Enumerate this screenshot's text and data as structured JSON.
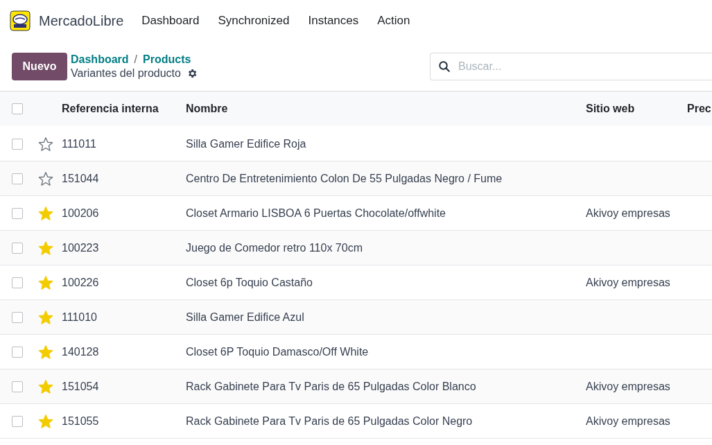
{
  "navbar": {
    "app_name": "MercadoLibre",
    "menu": [
      "Dashboard",
      "Synchronized",
      "Instances",
      "Action"
    ]
  },
  "control_panel": {
    "new_button": "Nuevo",
    "breadcrumbs": [
      "Dashboard",
      "Products"
    ],
    "separator": "/",
    "title": "Variantes del producto",
    "search": {
      "placeholder": "Buscar..."
    }
  },
  "table": {
    "select_all": {
      "checked": false
    },
    "columns": [
      "Referencia interna",
      "Nombre",
      "Sitio web",
      "Prec"
    ],
    "rows": [
      {
        "checked": false,
        "starred": false,
        "reference": "111011",
        "name": "Silla Gamer Edifice Roja"
      },
      {
        "checked": false,
        "starred": false,
        "reference": "151044",
        "name": "Centro De Entretenimiento Colon De 55 Pulgadas Negro / Fume"
      },
      {
        "checked": false,
        "starred": true,
        "reference": "100206",
        "name": "Closet Armario LISBOA 6 Puertas Chocolate/offwhite",
        "website": "Akivoy empresas"
      },
      {
        "checked": false,
        "starred": true,
        "reference": "100223",
        "name": "Juego de Comedor retro 110x 70cm"
      },
      {
        "checked": false,
        "starred": true,
        "reference": "100226",
        "name": "Closet 6p Toquio Castaño",
        "website": "Akivoy empresas"
      },
      {
        "checked": false,
        "starred": true,
        "reference": "111010",
        "name": "Silla Gamer Edifice Azul"
      },
      {
        "checked": false,
        "starred": true,
        "reference": "140128",
        "name": "Closet 6P Toquio Damasco/Off White"
      },
      {
        "checked": false,
        "starred": true,
        "reference": "151054",
        "name": "Rack Gabinete Para Tv Paris de 65 Pulgadas Color Blanco",
        "website": "Akivoy empresas"
      },
      {
        "checked": false,
        "starred": true,
        "reference": "151055",
        "name": "Rack Gabinete Para Tv Paris de 65 Pulgadas Color Negro",
        "website": "Akivoy empresas"
      }
    ]
  }
}
